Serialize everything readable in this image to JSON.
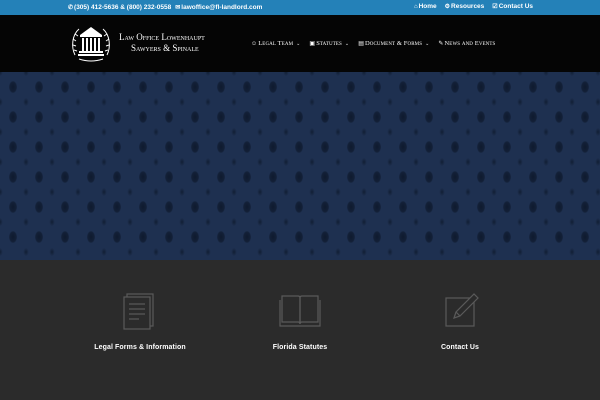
{
  "topbar": {
    "phone": "(305) 412-5636 & (800) 232-0558",
    "email": "lawoffice@fl-landlord.com",
    "links": [
      {
        "label": "Home",
        "icon": "home-icon"
      },
      {
        "label": "Resources",
        "icon": "gear-icon"
      },
      {
        "label": "Contact Us",
        "icon": "checkbox-icon"
      }
    ]
  },
  "header": {
    "logo_line1": "Law Office Lowenhaupt",
    "logo_line2": "Sawyers & Spinale",
    "nav": [
      {
        "label": "Legal Team",
        "icon": "user-icon"
      },
      {
        "label": "Statutes",
        "icon": "laptop-icon"
      },
      {
        "label": "Document & Forms",
        "icon": "document-icon"
      },
      {
        "label": "News and Events",
        "icon": "edit-icon"
      }
    ]
  },
  "features": [
    {
      "label": "Legal Forms & Information",
      "icon": "form-icon"
    },
    {
      "label": "Florida Statutes",
      "icon": "book-icon"
    },
    {
      "label": "Contact Us",
      "icon": "pencil-icon"
    }
  ],
  "colors": {
    "topbar": "#2481b8",
    "header": "#050505",
    "hero": "#1e3050",
    "footer": "#2b2b2b"
  }
}
